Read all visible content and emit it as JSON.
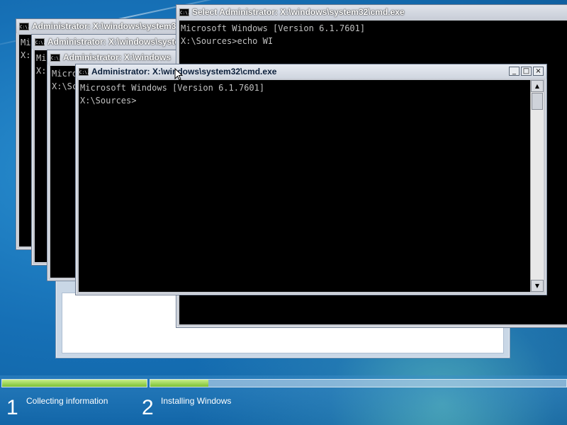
{
  "windows": [
    {
      "title": "Administrator: X:\\windows\\system32",
      "lines": [
        "Mi",
        "",
        "X:"
      ]
    },
    {
      "title": "Administrator: X:\\windows\\system32",
      "lines": [
        "Mi",
        "",
        "X:"
      ]
    },
    {
      "title": "Administrator: X:\\windows",
      "lines": [
        "Micro",
        "",
        "X:\\Sc"
      ]
    },
    {
      "title": "Select Administrator: X:\\windows\\system32\\cmd.exe",
      "lines": [
        "Microsoft Windows [Version 6.1.7601]",
        "",
        "X:\\Sources>echo WI"
      ]
    },
    {
      "title": "Administrator: X:\\windows\\system32\\cmd.exe",
      "lines": [
        "Microsoft Windows [Version 6.1.7601]",
        "",
        "X:\\Sources>"
      ]
    }
  ],
  "window_controls": {
    "minimize": "_",
    "maximize": "□",
    "close": "×"
  },
  "cmd_icon_text": "C:\\.",
  "scroll": {
    "up": "▲",
    "down": "▼"
  },
  "progress": {
    "steps": [
      {
        "number": "1",
        "label": "Collecting information",
        "progress": 1.0
      },
      {
        "number": "2",
        "label": "Installing Windows",
        "progress": 0.14
      }
    ]
  },
  "colors": {
    "progress_fill": "#7cc034",
    "console_bg": "#000000",
    "console_text": "#c0c0c0"
  }
}
